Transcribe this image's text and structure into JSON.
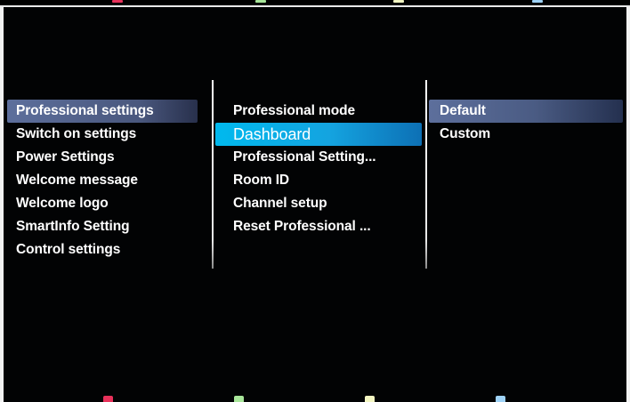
{
  "menu": {
    "col1": [
      "Professional settings",
      "Switch on settings",
      "Power Settings",
      "Welcome message",
      "Welcome logo",
      "SmartInfo Setting",
      "Control settings"
    ],
    "col2": [
      "Professional mode",
      "Dashboard",
      "Professional Setting...",
      "Room ID",
      "Channel setup",
      "Reset Professional ..."
    ],
    "col3": [
      "Default",
      "Custom"
    ]
  },
  "colors": {
    "red_key": "#e8315a",
    "green_key": "#a8e69a",
    "yellow_key": "#f3f6c2",
    "blue_key": "#9ed2f7",
    "focus_highlight": "#00b9ee",
    "path_highlight": "#5d6f9c"
  },
  "keys": [
    "red-key",
    "green-key",
    "yellow-key",
    "blue-key"
  ]
}
